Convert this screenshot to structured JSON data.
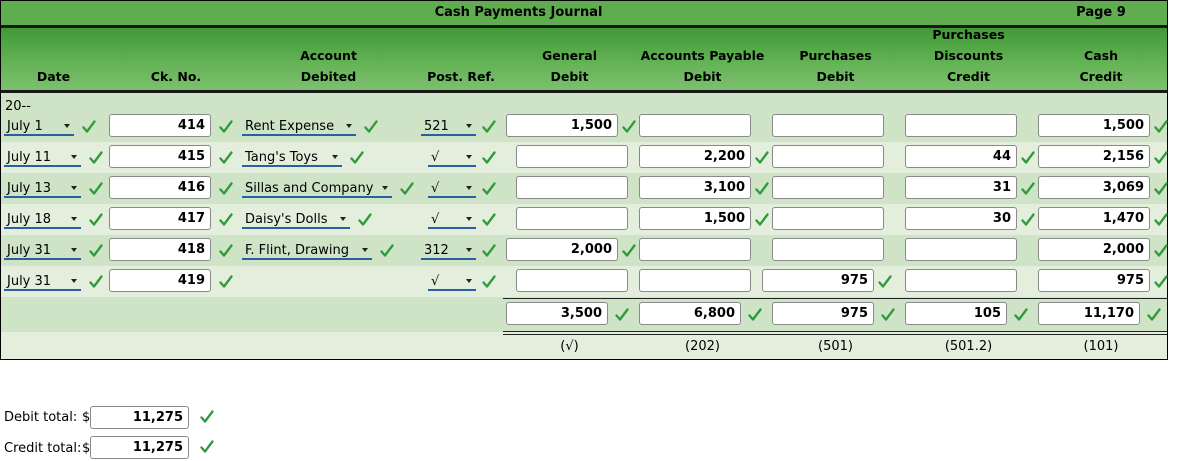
{
  "title": "Cash Payments Journal",
  "page_label": "Page 9",
  "headers": {
    "date": [
      "Date"
    ],
    "ck_no": [
      "Ck. No."
    ],
    "account": [
      "Account",
      "Debited"
    ],
    "post_ref": [
      "Post. Ref."
    ],
    "general": [
      "General",
      "Debit"
    ],
    "ap": [
      "Accounts Payable",
      "Debit"
    ],
    "purchases": [
      "Purchases",
      "Debit"
    ],
    "discounts": [
      "Purchases",
      "Discounts",
      "Credit"
    ],
    "cash": [
      "Cash",
      "Credit"
    ]
  },
  "year_label": "20--",
  "rows": [
    {
      "date": "July 1",
      "ck": "414",
      "account": "Rent Expense",
      "ref": "521",
      "general": "1,500",
      "ap": "",
      "purchases": "",
      "discounts": "",
      "cash": "1,500"
    },
    {
      "date": "July 11",
      "ck": "415",
      "account": "Tang's Toys",
      "ref": "√",
      "general": "",
      "ap": "2,200",
      "purchases": "",
      "discounts": "44",
      "cash": "2,156"
    },
    {
      "date": "July 13",
      "ck": "416",
      "account": "Sillas and Company",
      "ref": "√",
      "general": "",
      "ap": "3,100",
      "purchases": "",
      "discounts": "31",
      "cash": "3,069"
    },
    {
      "date": "July 18",
      "ck": "417",
      "account": "Daisy's Dolls",
      "ref": "√",
      "general": "",
      "ap": "1,500",
      "purchases": "",
      "discounts": "30",
      "cash": "1,470"
    },
    {
      "date": "July 31",
      "ck": "418",
      "account": "F. Flint, Drawing",
      "ref": "312",
      "general": "2,000",
      "ap": "",
      "purchases": "",
      "discounts": "",
      "cash": "2,000"
    },
    {
      "date": "July 31",
      "ck": "419",
      "account": "",
      "ref": "√",
      "general": "",
      "ap": "",
      "purchases": "975",
      "discounts": "",
      "cash": "975"
    }
  ],
  "totals": {
    "general": "3,500",
    "ap": "6,800",
    "purchases": "975",
    "discounts": "105",
    "cash": "11,170"
  },
  "posting_refs": {
    "general": "(√)",
    "ap": "(202)",
    "purchases": "(501)",
    "discounts": "(501.2)",
    "cash": "(101)"
  },
  "summary": {
    "debit_label": "Debit total:",
    "credit_label": "Credit total:",
    "currency": "$",
    "debit_total": "11,275",
    "credit_total": "11,275"
  },
  "colors": {
    "check": "#2e9a3a",
    "header": "#5fad4f",
    "select_underline": "#2a5fa0"
  }
}
